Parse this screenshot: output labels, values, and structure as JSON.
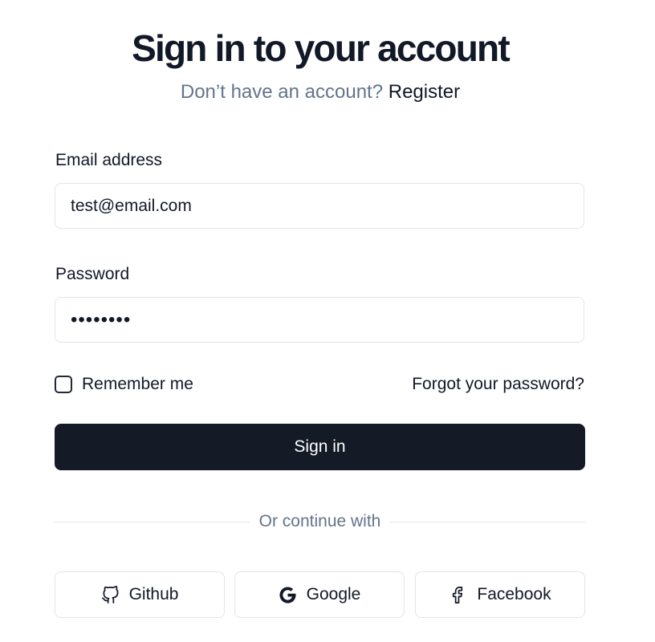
{
  "header": {
    "title": "Sign in to your account",
    "subtitle_prompt": "Don’t have an account?",
    "register_link": "Register"
  },
  "form": {
    "email_label": "Email address",
    "email_value": "test@email.com",
    "password_label": "Password",
    "password_value": "••••••••",
    "remember_label": "Remember me",
    "remember_checked": false,
    "forgot_link": "Forgot your password?",
    "submit_label": "Sign in"
  },
  "divider": {
    "text": "Or continue with"
  },
  "social": [
    {
      "label": "Github",
      "icon": "github-icon"
    },
    {
      "label": "Google",
      "icon": "google-icon"
    },
    {
      "label": "Facebook",
      "icon": "facebook-icon"
    }
  ],
  "colors": {
    "primary_button": "#141a26",
    "muted_text": "#64748b",
    "border": "#e2e5ea"
  }
}
